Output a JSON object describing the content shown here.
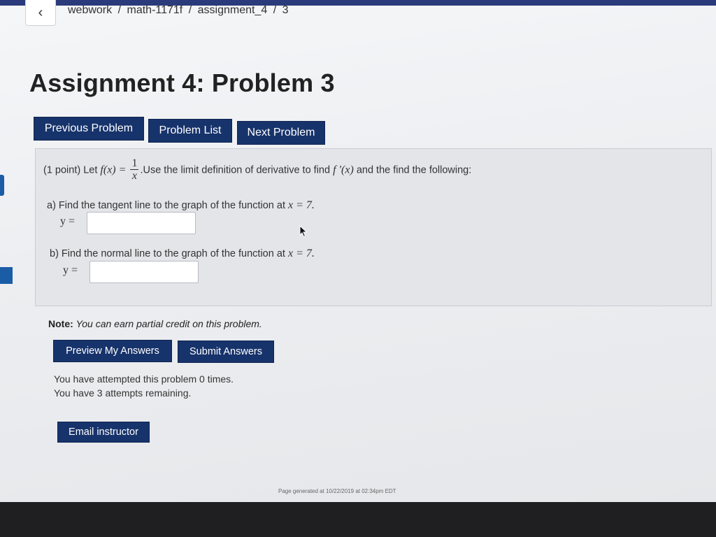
{
  "breadcrumb": {
    "items": [
      "webwork",
      "math-1171f",
      "assignment_4",
      "3"
    ],
    "separator": "/"
  },
  "back_icon": "chevron-left-icon",
  "page_title": "Assignment 4: Problem 3",
  "nav": {
    "previous": "Previous Problem",
    "list": "Problem List",
    "next": "Next Problem"
  },
  "problem": {
    "intro_prefix": "(1 point) Let ",
    "function_lhs": "f(x) =",
    "fraction_num": "1",
    "fraction_den": "x",
    "intro_suffix": ".Use the limit definition of derivative to find ",
    "derivative": "f ′(x)",
    "intro_tail": " and the find the following:",
    "part_a_text": "a) Find the tangent line to the graph of the function at ",
    "part_a_math": "x = 7.",
    "part_a_label": "y =",
    "part_b_text": "b) Find the normal line to the graph of the function at ",
    "part_b_math": "x = 7.",
    "part_b_label": "y =",
    "answer_a_value": "",
    "answer_b_value": ""
  },
  "note": {
    "label": "Note:",
    "text": "You can earn partial credit on this problem."
  },
  "actions": {
    "preview": "Preview My Answers",
    "submit": "Submit Answers"
  },
  "attempts": {
    "made": "You have attempted this problem 0 times.",
    "remaining": "You have 3 attempts remaining."
  },
  "email_instructor": "Email instructor",
  "footer": {
    "generated": "Page generated at 10/22/2019 at 02:34pm EDT"
  },
  "colors": {
    "button_bg": "#17336b",
    "page_bg": "#eceef1",
    "problem_box_bg": "#e3e5e9"
  }
}
